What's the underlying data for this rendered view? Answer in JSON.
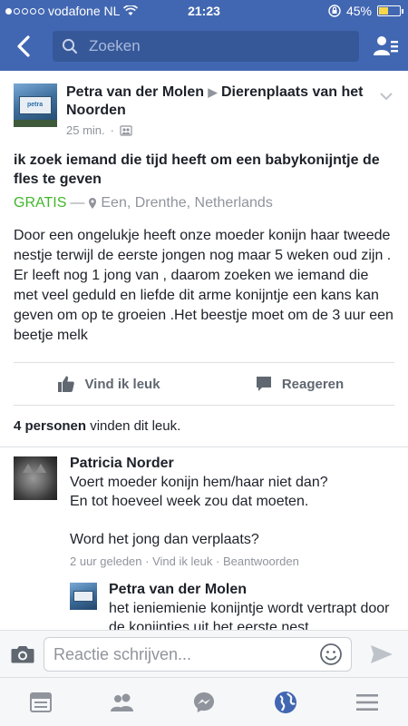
{
  "status_bar": {
    "carrier": "vodafone NL",
    "time": "21:23",
    "battery": "45%",
    "battery_level": 0.45,
    "signal_bars": 1
  },
  "nav": {
    "search_placeholder": "Zoeken"
  },
  "post": {
    "author": "Petra van der Molen",
    "target": "Dierenplaats van het Noorden",
    "time": "25 min.",
    "title": "ik zoek iemand die tijd heeft om een babykonijntje de fles te geven",
    "price": "GRATIS",
    "location": "Een, Drenthe, Netherlands",
    "body": "Door een ongelukje heeft onze moeder konijn haar tweede nestje terwijl de eerste jongen nog maar 5 weken oud zijn . Er leeft nog 1 jong van , daarom zoeken we iemand die met veel geduld en liefde dit arme konijntje een kans kan geven om op te groeien .Het beestje moet om de 3 uur een beetje melk",
    "like_label": "Vind ik leuk",
    "comment_label": "Reageren",
    "likes_count": "4 personen",
    "likes_suffix": "vinden dit leuk."
  },
  "comments": [
    {
      "name": "Patricia Norder",
      "text": "Voert moeder konijn hem/haar niet dan?\nEn tot hoeveel week zou dat moeten.\n\nWord het jong dan verplaats?",
      "time": "2 uur geleden",
      "like": "Vind ik leuk",
      "reply": "Beantwoorden",
      "separator": "·"
    }
  ],
  "reply": {
    "name": "Petra van der Molen",
    "text": "het ieniemienie konijntje wordt vertrapt door de konijntjes uit het eerste nest ."
  },
  "composer": {
    "placeholder": "Reactie schrijven..."
  },
  "colors": {
    "brand": "#4267b2",
    "free_green": "#42b72a",
    "active_tab": "#4267b2",
    "inactive_tab": "#90949c"
  },
  "tabs": [
    "news-feed-icon",
    "friends-icon",
    "messenger-icon",
    "globe-icon",
    "menu-icon"
  ]
}
